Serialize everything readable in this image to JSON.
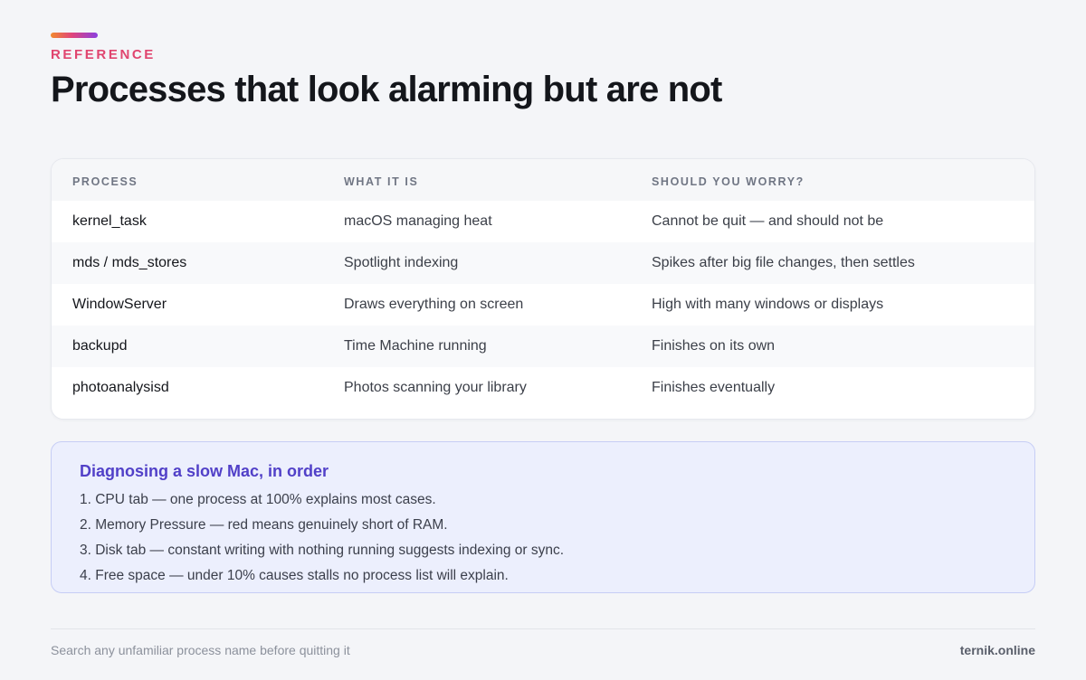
{
  "header": {
    "eyebrow": "REFERENCE",
    "title": "Processes that look alarming but are not"
  },
  "table": {
    "columns": [
      "PROCESS",
      "WHAT IT IS",
      "SHOULD YOU WORRY?"
    ],
    "rows": [
      {
        "process": "kernel_task",
        "what": "macOS managing heat",
        "worry": "Cannot be quit — and should not be"
      },
      {
        "process": "mds / mds_stores",
        "what": "Spotlight indexing",
        "worry": "Spikes after big file changes, then settles"
      },
      {
        "process": "WindowServer",
        "what": "Draws everything on screen",
        "worry": "High with many windows or displays"
      },
      {
        "process": "backupd",
        "what": "Time Machine running",
        "worry": "Finishes on its own"
      },
      {
        "process": "photoanalysisd",
        "what": "Photos scanning your library",
        "worry": "Finishes eventually"
      }
    ]
  },
  "diagnosis": {
    "title": "Diagnosing a slow Mac, in order",
    "steps": [
      "1. CPU tab — one process at 100% explains most cases.",
      "2. Memory Pressure — red means genuinely short of RAM.",
      "3. Disk tab — constant writing with nothing running suggests indexing or sync.",
      "4. Free space — under 10% causes stalls no process list will explain."
    ]
  },
  "footer": {
    "note": "Search any unfamiliar process name before quitting it",
    "brand": "ternik.online"
  },
  "colors": {
    "eyebrow": "#e0456f",
    "diagnosis_title": "#5140c8",
    "diagnosis_bg": "#eceffd"
  }
}
